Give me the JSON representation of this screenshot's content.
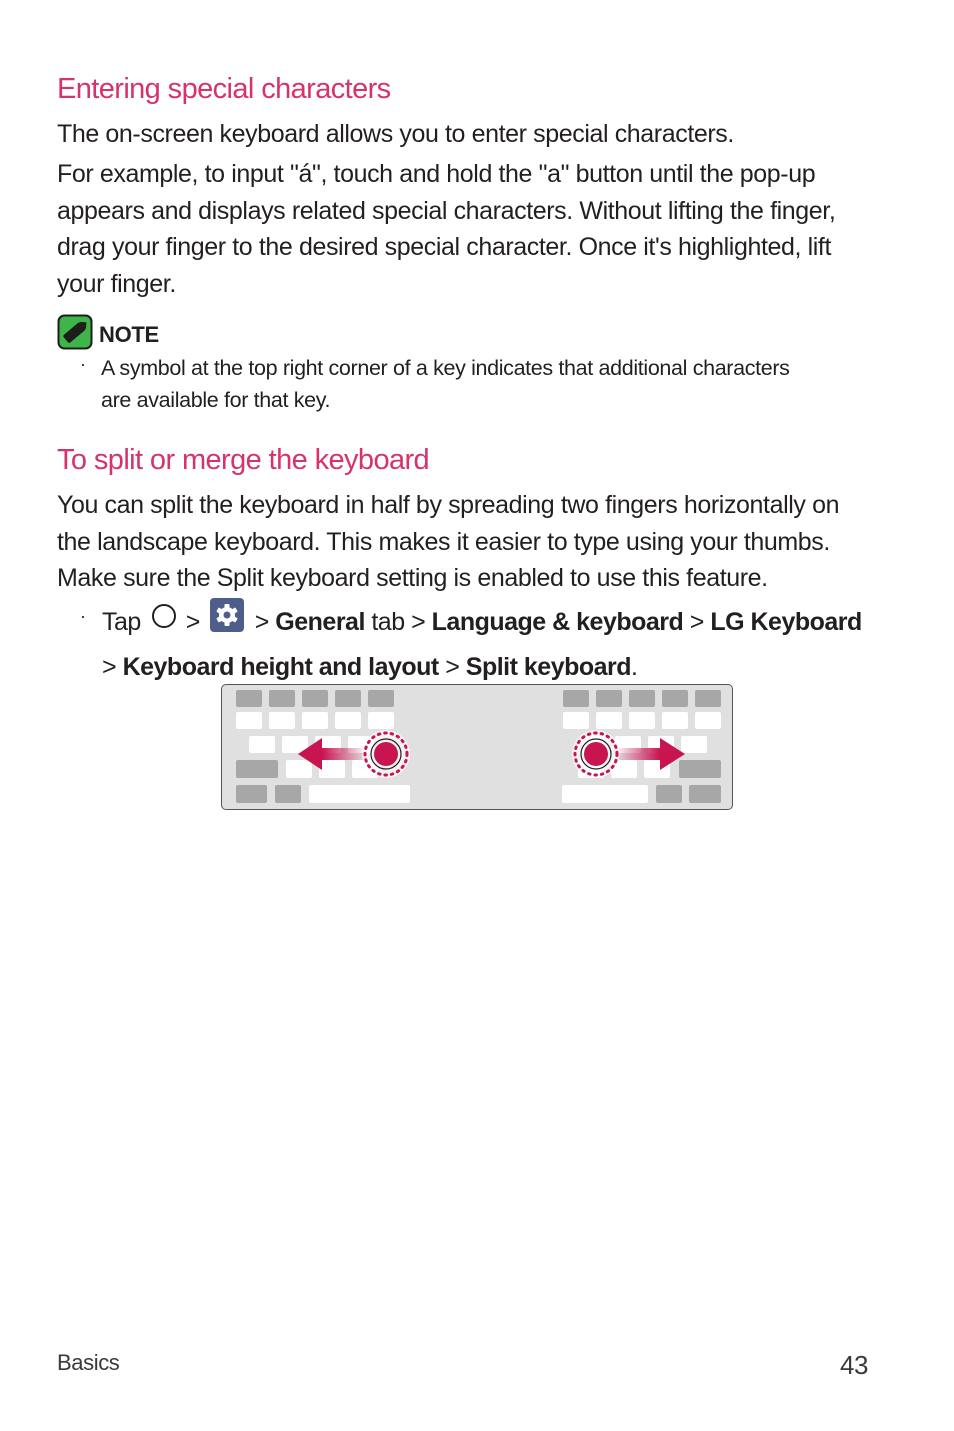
{
  "section1": {
    "heading": "Entering special characters",
    "para1": "The on-screen keyboard allows you to enter special characters.",
    "para2_lines": [
      "For example, to input \"á\", touch and hold the \"a\" button until the pop-up",
      "appears and displays related special characters. Without lifting the finger,",
      "drag your finger to the desired special character. Once it's highlighted, lift",
      "your finger."
    ]
  },
  "note": {
    "icon": "note-pencil-icon",
    "label": "NOTE",
    "bullet": "·",
    "lines": [
      "A symbol at the top right corner of a key indicates that additional characters",
      "are available for that key."
    ]
  },
  "section2": {
    "heading": "To split or merge the keyboard",
    "para_lines": [
      "You can split the keyboard in half by spreading two fingers horizontally on",
      "the landscape keyboard. This makes it easier to type using your thumbs.",
      "Make sure the Split keyboard setting is enabled to use this feature."
    ],
    "steps": {
      "bullet": "·",
      "tap": "Tap",
      "home_icon": "home-circle-icon",
      "settings_icon": "settings-gear-icon",
      "sep": ">",
      "general": "General",
      "tab": "tab",
      "language": "Language & keyboard",
      "lg_keyboard": "LG Keyboard",
      "height_layout": "Keyboard height and layout",
      "split": "Split keyboard",
      "period": "."
    },
    "illustration": {
      "name": "split-keyboard-illustration",
      "accent_color": "#c8144f"
    }
  },
  "footer": {
    "section": "Basics",
    "page_number": "43"
  }
}
